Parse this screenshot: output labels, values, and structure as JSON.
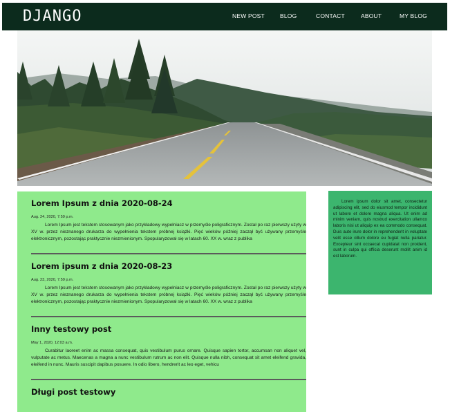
{
  "nav": {
    "brand": "DJANGO",
    "links": [
      "NEW POST",
      "BLOG",
      "CONTACT",
      "ABOUT",
      "MY BLOG"
    ]
  },
  "posts": [
    {
      "title": "Lorem Ipsum z dnia 2020-08-24",
      "date": "Aug. 24, 2020, 7:59 p.m.",
      "body": "Lorem Ipsum jest tekstem stosowanym jako przykładowy wypełniacz w przemyśle poligraficznym. Został po raz pierwszy użyty w XV w. przez nieznanego drukarza do wypełnienia tekstem próbnej książki. Pięć wieków później zaczął być używany przemyśle elektronicznym, pozostając praktycznie niezmienionym. Spopularyzował się w latach 60. XX w. wraz z publika"
    },
    {
      "title": "Lorem ipsum z dnia 2020-08-23",
      "date": "Aug. 23, 2020, 7:59 p.m.",
      "body": "Lorem Ipsum jest tekstem stosowanym jako przykładowy wypełniacz w przemyśle poligraficznym. Został po raz pierwszy użyty w XV w. przez nieznanego drukarza do wypełnienia tekstem próbnej książki. Pięć wieków później zaczął być używany przemyśle elektronicznym, pozostając praktycznie niezmienionym. Spopularyzował się w latach 60. XX w. wraz z publika"
    },
    {
      "title": "Inny testowy post",
      "date": "May 1, 2020, 12:03 a.m.",
      "body": "Curabitur laoreet enim ac massa consequat, quis vestibulum purus ornare. Quisque sapien tortor, accumsan non aliquet vel, vulputate ac metus. Maecenas a magna a nunc vestibulum rutrum ac non elit. Quisque nulla nibh, consequat sit amet eleifend gravida, eleifend in nunc. Mauris suscipit dapibus posuere. In odio libero, hendrerit ac leo eget, vehicu"
    },
    {
      "title": "Długi post testowy",
      "date": "",
      "body": ""
    }
  ],
  "sidebar": {
    "text": "Lorem ipsum dolor sit amet, consectetur adipiscing elit, sed do eiusmod tempor incididunt ut labore et dolore magna aliqua. Ut enim ad minim veniam, quis nostrud exercitation ullamco laboris nisi ut aliquip ex ea commodo consequat. Duis aute irure dolor in reprehenderit in voluptate velit esse cillum dolore eu fugiat nulla pariatur. Excepteur sint occaecat cupidatat non proident, sunt in culpa qui officia deserunt mollit anim id est laborum."
  },
  "colors": {
    "navbar": "#0c2b1d",
    "posts_bg": "#8fea8c",
    "sidebar_bg": "#3cb56e"
  },
  "hero": {
    "image": "road-through-forest"
  }
}
